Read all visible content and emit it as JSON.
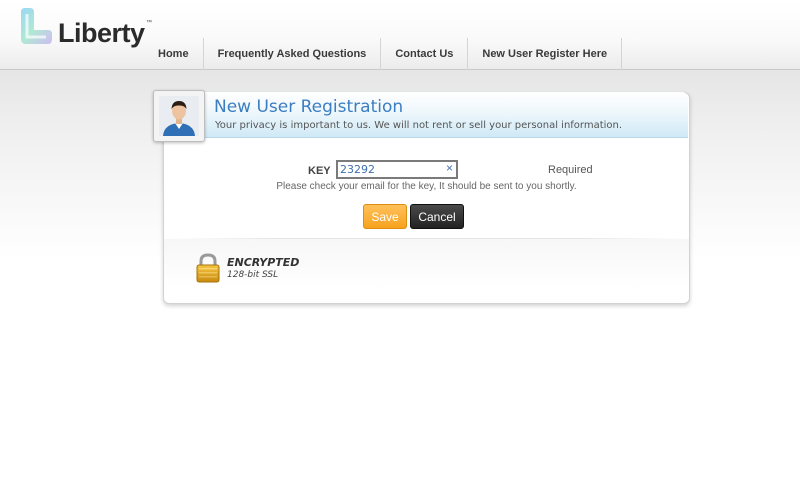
{
  "header": {
    "logo_text": "Liberty",
    "logo_tm": "™",
    "nav": [
      {
        "label": "Home"
      },
      {
        "label": "Frequently Asked Questions"
      },
      {
        "label": "Contact Us"
      },
      {
        "label": "New User Register Here"
      }
    ]
  },
  "registration": {
    "title": "New User Registration",
    "subtitle": "Your privacy is important to us. We will not rent or sell your personal information.",
    "key_label": "KEY",
    "key_value": "23292",
    "clear_symbol": "×",
    "required_text": "Required",
    "hint": "Please check your email for the key, It should be sent to you shortly.",
    "save_label": "Save",
    "cancel_label": "Cancel"
  },
  "security": {
    "title": "ENCRYPTED",
    "subtitle": "128-bit SSL"
  },
  "colors": {
    "title_blue": "#3b7ec2",
    "save_orange": "#f7a21e",
    "cancel_dark": "#222222"
  },
  "icons": {
    "logo": "liberty-logo-icon",
    "avatar": "user-avatar-icon",
    "clear": "clear-icon",
    "lock": "padlock-icon"
  }
}
